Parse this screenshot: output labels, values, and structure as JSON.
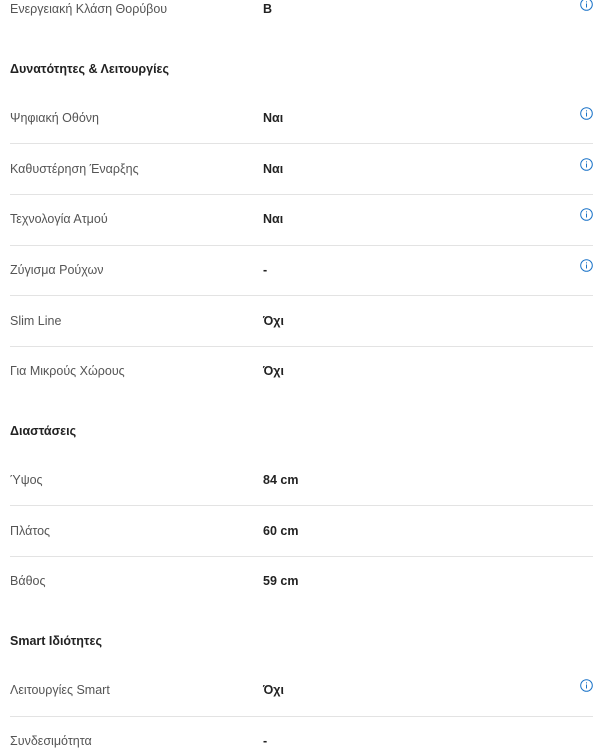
{
  "rows_top": [
    {
      "label": "Ενεργειακή Κλάση Θορύβου",
      "value": "B",
      "info": true
    }
  ],
  "sections": [
    {
      "title": "Δυνατότητες & Λειτουργίες",
      "rows": [
        {
          "label": "Ψηφιακή Οθόνη",
          "value": "Ναι",
          "info": true
        },
        {
          "label": "Καθυστέρηση Έναρξης",
          "value": "Ναι",
          "info": true
        },
        {
          "label": "Τεχνολογία Ατμού",
          "value": "Ναι",
          "info": true
        },
        {
          "label": "Ζύγισμα Ρούχων",
          "value": "-",
          "info": true
        },
        {
          "label": "Slim Line",
          "value": "Όχι",
          "info": false
        },
        {
          "label": "Για Μικρούς Χώρους",
          "value": "Όχι",
          "info": false
        }
      ]
    },
    {
      "title": "Διαστάσεις",
      "rows": [
        {
          "label": "Ύψος",
          "value": "84 cm",
          "info": false
        },
        {
          "label": "Πλάτος",
          "value": "60 cm",
          "info": false
        },
        {
          "label": "Βάθος",
          "value": "59 cm",
          "info": false
        }
      ]
    },
    {
      "title": "Smart Ιδιότητες",
      "rows": [
        {
          "label": "Λειτουργίες Smart",
          "value": "Όχι",
          "info": true
        },
        {
          "label": "Συνδεσιμότητα",
          "value": "-",
          "info": false
        }
      ]
    }
  ],
  "colors": {
    "info_icon": "#1a73c8",
    "divider": "#e3e3e3"
  }
}
